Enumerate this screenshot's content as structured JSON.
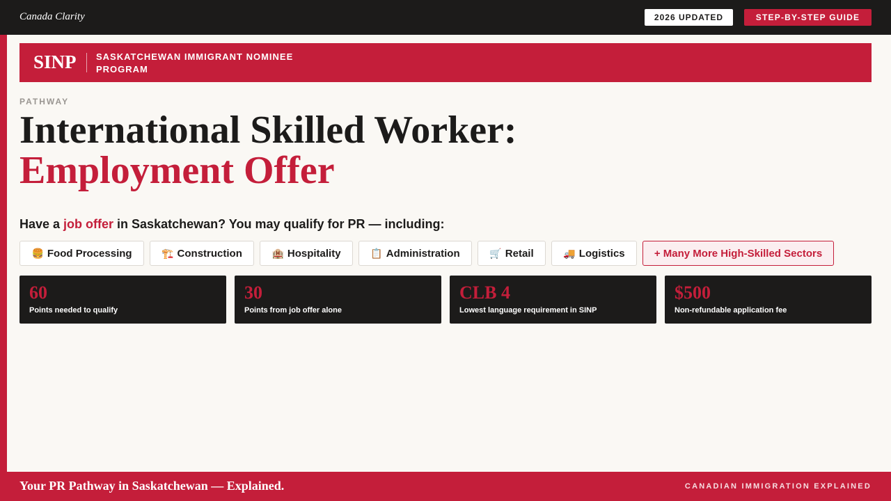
{
  "topbar": {
    "brand": "Canada Clarity",
    "updated_label": "2026 UPDATED",
    "guide_label": "STEP-BY-STEP GUIDE"
  },
  "banner": {
    "acronym": "SINP",
    "name": "SASKATCHEWAN IMMIGRANT NOMINEE PROGRAM"
  },
  "header": {
    "eyebrow": "PATHWAY",
    "title_line1": "International Skilled Worker:",
    "title_line2": "Employment Offer"
  },
  "lead": {
    "prefix": "Have a ",
    "highlight": "job offer",
    "suffix": " in Saskatchewan? You may qualify for PR — including:"
  },
  "sectors": [
    {
      "icon": "burger-icon",
      "glyph": "🍔",
      "label": "Food Processing"
    },
    {
      "icon": "crane-icon",
      "glyph": "🏗️",
      "label": "Construction"
    },
    {
      "icon": "hotel-icon",
      "glyph": "🏨",
      "label": "Hospitality"
    },
    {
      "icon": "clipboard-icon",
      "glyph": "📋",
      "label": "Administration"
    },
    {
      "icon": "shopping-cart-icon",
      "glyph": "🛒",
      "label": "Retail"
    },
    {
      "icon": "truck-icon",
      "glyph": "🚚",
      "label": "Logistics"
    },
    {
      "icon": "",
      "glyph": "",
      "label": "+ Many More High-Skilled Sectors"
    }
  ],
  "stats": [
    {
      "value": "60",
      "label": "Points needed to qualify"
    },
    {
      "value": "30",
      "label": "Points from job offer alone"
    },
    {
      "value": "CLB 4",
      "label": "Lowest language requirement in SINP"
    },
    {
      "value": "$500",
      "label": "Non-refundable application fee"
    }
  ],
  "footer": {
    "tagline": "Your PR Pathway in Saskatchewan — Explained.",
    "right_label": "CANADIAN IMMIGRATION EXPLAINED"
  },
  "colors": {
    "accent": "#c41e3a",
    "dark": "#1c1b1a",
    "background": "#faf8f4"
  }
}
